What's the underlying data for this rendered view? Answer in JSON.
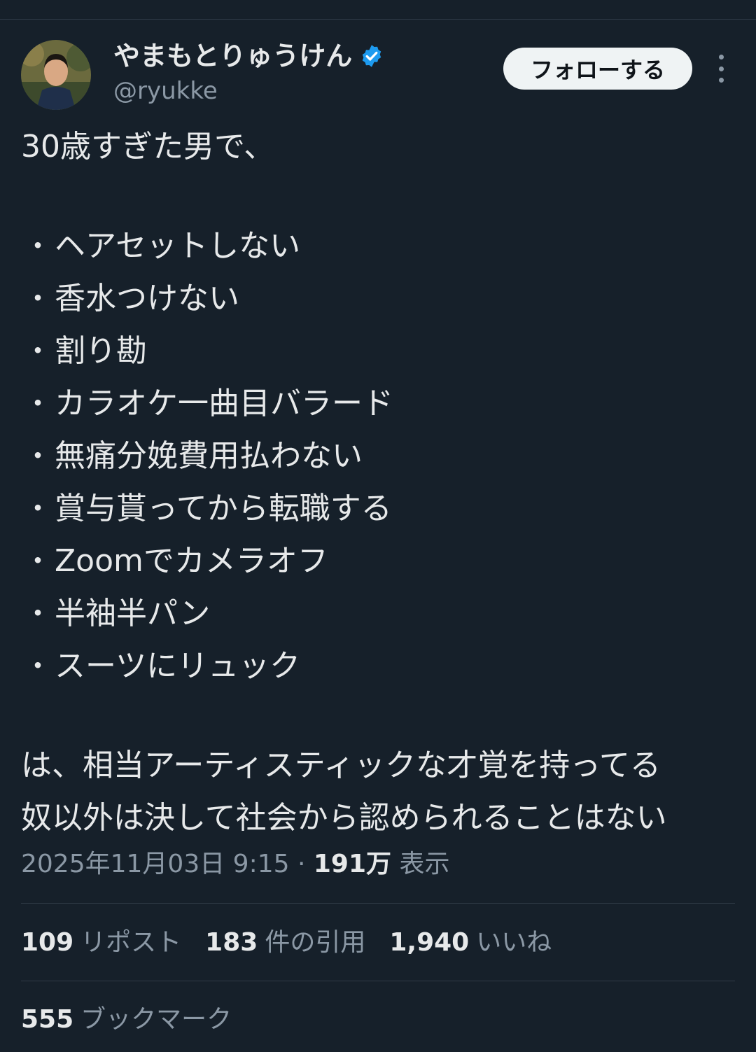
{
  "author": {
    "display_name": "やまもとりゅうけん",
    "handle": "@ryukke",
    "verified_icon": "verified-badge-icon",
    "accent_color": "#1d9bf0"
  },
  "follow_label": "フォローする",
  "tweet": {
    "intro": "30歳すぎた男で、",
    "bullet_symbol": "・",
    "items": [
      "ヘアセットしない",
      "香水つけない",
      "割り勘",
      "カラオケ一曲目バラード",
      "無痛分娩費用払わない",
      "賞与貰ってから転職する",
      "Zoomでカメラオフ",
      "半袖半パン",
      "スーツにリュック"
    ],
    "outro_line1": "は、相当アーティスティックな才覚を持ってる",
    "outro_line2": "奴以外は決して社会から認められることはない"
  },
  "meta": {
    "datetime": "2025年11月03日 9:15",
    "separator": " · ",
    "views_count": "191万",
    "views_label": "表示"
  },
  "stats": {
    "reposts": {
      "count": "109",
      "label": "リポスト"
    },
    "quotes": {
      "count": "183",
      "label": "件の引用"
    },
    "likes": {
      "count": "1,940",
      "label": "いいね"
    },
    "bookmarks": {
      "count": "555",
      "label": "ブックマーク"
    }
  }
}
